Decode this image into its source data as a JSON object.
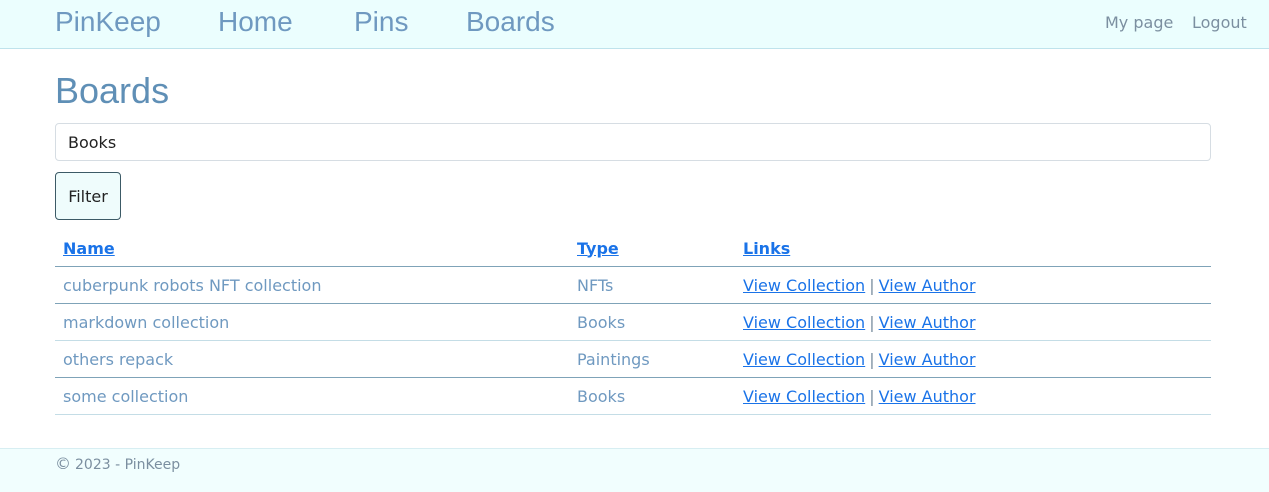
{
  "nav": {
    "brand": "PinKeep",
    "links": [
      "Home",
      "Pins",
      "Boards"
    ],
    "right_links": [
      "My page",
      "Logout"
    ]
  },
  "page": {
    "title": "Boards"
  },
  "filter": {
    "value": "Books",
    "button_label": "Filter"
  },
  "table": {
    "headers": [
      "Name",
      "Type",
      "Links"
    ],
    "rows": [
      {
        "name": "cuberpunk robots NFT collection",
        "type": "NFTs",
        "link1": "View Collection",
        "sep": "|",
        "link2": "View Author"
      },
      {
        "name": "markdown collection",
        "type": "Books",
        "link1": "View Collection",
        "sep": "|",
        "link2": "View Author"
      },
      {
        "name": "others repack",
        "type": "Paintings",
        "link1": "View Collection",
        "sep": "|",
        "link2": "View Author"
      },
      {
        "name": "some collection",
        "type": "Books",
        "link1": "View Collection",
        "sep": "|",
        "link2": "View Author"
      }
    ]
  },
  "footer": {
    "copyright_symbol": "©",
    "text": "2023 - PinKeep"
  },
  "colors": {
    "navbar_bg": "#ebfefe",
    "brand_blue": "#6f99c0",
    "link_blue": "#1a73e8",
    "footer_bg": "#f1fefe"
  }
}
